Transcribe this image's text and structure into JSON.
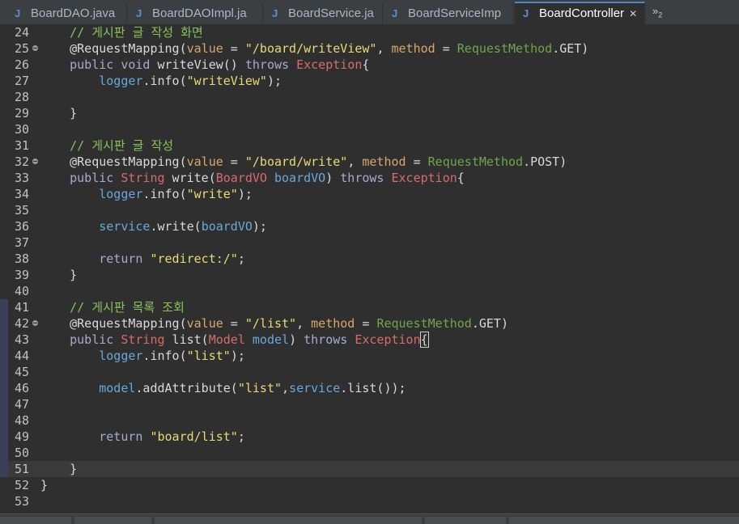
{
  "tabs": [
    {
      "label": "BoardDAO.java",
      "icon": "java-file-icon",
      "active": false
    },
    {
      "label": "BoardDAOImpl.ja",
      "icon": "java-file-icon",
      "active": false
    },
    {
      "label": "BoardService.ja",
      "icon": "java-file-icon",
      "active": false
    },
    {
      "label": "BoardServiceImp",
      "icon": "java-file-icon",
      "active": false
    },
    {
      "label": "BoardController",
      "icon": "java-file-icon",
      "active": true
    }
  ],
  "overflow": {
    "symbol": "»",
    "count": "2"
  },
  "lines": [
    {
      "n": "24",
      "tokens": [
        [
          "    ",
          ""
        ],
        [
          "// 게시판 글 작성 화면",
          "com"
        ]
      ]
    },
    {
      "n": "25",
      "fold": true,
      "tokens": [
        [
          "    @RequestMapping(",
          "ann"
        ],
        [
          "value",
          "param"
        ],
        [
          " = ",
          ""
        ],
        [
          "\"/board/writeView\"",
          "str"
        ],
        [
          ", ",
          ""
        ],
        [
          "method",
          "param"
        ],
        [
          " = ",
          ""
        ],
        [
          "RequestMethod",
          "enum"
        ],
        [
          ".GET)",
          ""
        ]
      ]
    },
    {
      "n": "26",
      "tokens": [
        [
          "    ",
          ""
        ],
        [
          "public",
          "kwb"
        ],
        [
          " ",
          ""
        ],
        [
          "void",
          "kwb"
        ],
        [
          " writeView() ",
          ""
        ],
        [
          "throws",
          "kwb"
        ],
        [
          " ",
          ""
        ],
        [
          "Exception",
          "ty"
        ],
        [
          "{",
          ""
        ]
      ]
    },
    {
      "n": "27",
      "tokens": [
        [
          "        ",
          ""
        ],
        [
          "logger",
          "field"
        ],
        [
          ".info(",
          ""
        ],
        [
          "\"writeView\"",
          "str"
        ],
        [
          ");",
          ""
        ]
      ]
    },
    {
      "n": "28",
      "tokens": []
    },
    {
      "n": "29",
      "tokens": [
        [
          "    }",
          ""
        ]
      ]
    },
    {
      "n": "30",
      "tokens": []
    },
    {
      "n": "31",
      "tokens": [
        [
          "    ",
          ""
        ],
        [
          "// 게시판 글 작성",
          "com"
        ]
      ]
    },
    {
      "n": "32",
      "fold": true,
      "tokens": [
        [
          "    @RequestMapping(",
          "ann"
        ],
        [
          "value",
          "param"
        ],
        [
          " = ",
          ""
        ],
        [
          "\"/board/write\"",
          "str"
        ],
        [
          ", ",
          ""
        ],
        [
          "method",
          "param"
        ],
        [
          " = ",
          ""
        ],
        [
          "RequestMethod",
          "enum"
        ],
        [
          ".POST)",
          ""
        ]
      ]
    },
    {
      "n": "33",
      "tokens": [
        [
          "    ",
          ""
        ],
        [
          "public",
          "kwb"
        ],
        [
          " ",
          ""
        ],
        [
          "String",
          "ty"
        ],
        [
          " write(",
          ""
        ],
        [
          "BoardVO",
          "ty"
        ],
        [
          " ",
          ""
        ],
        [
          "boardVO",
          "field"
        ],
        [
          ") ",
          ""
        ],
        [
          "throws",
          "kwb"
        ],
        [
          " ",
          ""
        ],
        [
          "Exception",
          "ty"
        ],
        [
          "{",
          ""
        ]
      ]
    },
    {
      "n": "34",
      "tokens": [
        [
          "        ",
          ""
        ],
        [
          "logger",
          "field"
        ],
        [
          ".info(",
          ""
        ],
        [
          "\"write\"",
          "str"
        ],
        [
          ");",
          ""
        ]
      ]
    },
    {
      "n": "35",
      "tokens": []
    },
    {
      "n": "36",
      "tokens": [
        [
          "        ",
          ""
        ],
        [
          "service",
          "field"
        ],
        [
          ".write(",
          ""
        ],
        [
          "boardVO",
          "field"
        ],
        [
          ");",
          ""
        ]
      ]
    },
    {
      "n": "37",
      "tokens": []
    },
    {
      "n": "38",
      "tokens": [
        [
          "        ",
          ""
        ],
        [
          "return",
          "kwb"
        ],
        [
          " ",
          ""
        ],
        [
          "\"redirect:/\"",
          "str"
        ],
        [
          ";",
          ""
        ]
      ]
    },
    {
      "n": "39",
      "tokens": [
        [
          "    }",
          ""
        ]
      ]
    },
    {
      "n": "40",
      "tokens": []
    },
    {
      "n": "41",
      "ruler": true,
      "tokens": [
        [
          "    ",
          ""
        ],
        [
          "// 게시판 목록 조회",
          "com"
        ]
      ]
    },
    {
      "n": "42",
      "ruler": true,
      "fold": true,
      "tokens": [
        [
          "    @RequestMapping(",
          "ann"
        ],
        [
          "value",
          "param"
        ],
        [
          " = ",
          ""
        ],
        [
          "\"/list\"",
          "str"
        ],
        [
          ", ",
          ""
        ],
        [
          "method",
          "param"
        ],
        [
          " = ",
          ""
        ],
        [
          "RequestMethod",
          "enum"
        ],
        [
          ".GET)",
          ""
        ]
      ]
    },
    {
      "n": "43",
      "ruler": true,
      "tokens": [
        [
          "    ",
          ""
        ],
        [
          "public",
          "kwb"
        ],
        [
          " ",
          ""
        ],
        [
          "String",
          "ty"
        ],
        [
          " list(",
          ""
        ],
        [
          "Model",
          "ty"
        ],
        [
          " ",
          ""
        ],
        [
          "model",
          "field"
        ],
        [
          ") ",
          ""
        ],
        [
          "throws",
          "kwb"
        ],
        [
          " ",
          ""
        ],
        [
          "Exception",
          "ty"
        ],
        [
          "{",
          "box"
        ]
      ]
    },
    {
      "n": "44",
      "ruler": true,
      "tokens": [
        [
          "        ",
          ""
        ],
        [
          "logger",
          "field"
        ],
        [
          ".info(",
          ""
        ],
        [
          "\"list\"",
          "str"
        ],
        [
          ");",
          ""
        ]
      ]
    },
    {
      "n": "45",
      "ruler": true,
      "tokens": []
    },
    {
      "n": "46",
      "ruler": true,
      "tokens": [
        [
          "        ",
          ""
        ],
        [
          "model",
          "field"
        ],
        [
          ".addAttribute(",
          ""
        ],
        [
          "\"list\"",
          "str"
        ],
        [
          ",",
          ""
        ],
        [
          "service",
          "field"
        ],
        [
          ".list());",
          ""
        ]
      ]
    },
    {
      "n": "47",
      "ruler": true,
      "tokens": []
    },
    {
      "n": "48",
      "ruler": true,
      "tokens": []
    },
    {
      "n": "49",
      "ruler": true,
      "tokens": [
        [
          "        ",
          ""
        ],
        [
          "return",
          "kwb"
        ],
        [
          " ",
          ""
        ],
        [
          "\"board/list\"",
          "str"
        ],
        [
          ";",
          ""
        ]
      ]
    },
    {
      "n": "50",
      "ruler": true,
      "tokens": []
    },
    {
      "n": "51",
      "ruler": true,
      "current": true,
      "tokens": [
        [
          "    }",
          ""
        ]
      ]
    },
    {
      "n": "52",
      "tokens": [
        [
          "}",
          ""
        ]
      ]
    },
    {
      "n": "53",
      "tokens": []
    }
  ],
  "colors": {
    "background": "#2f2f2f",
    "comment": "#87c35a",
    "string": "#e6db74",
    "keyword": "#aaa9cf",
    "type": "#d86b6b",
    "enum": "#6fa64b",
    "field": "#66a9d9",
    "param": "#d7a76a"
  }
}
